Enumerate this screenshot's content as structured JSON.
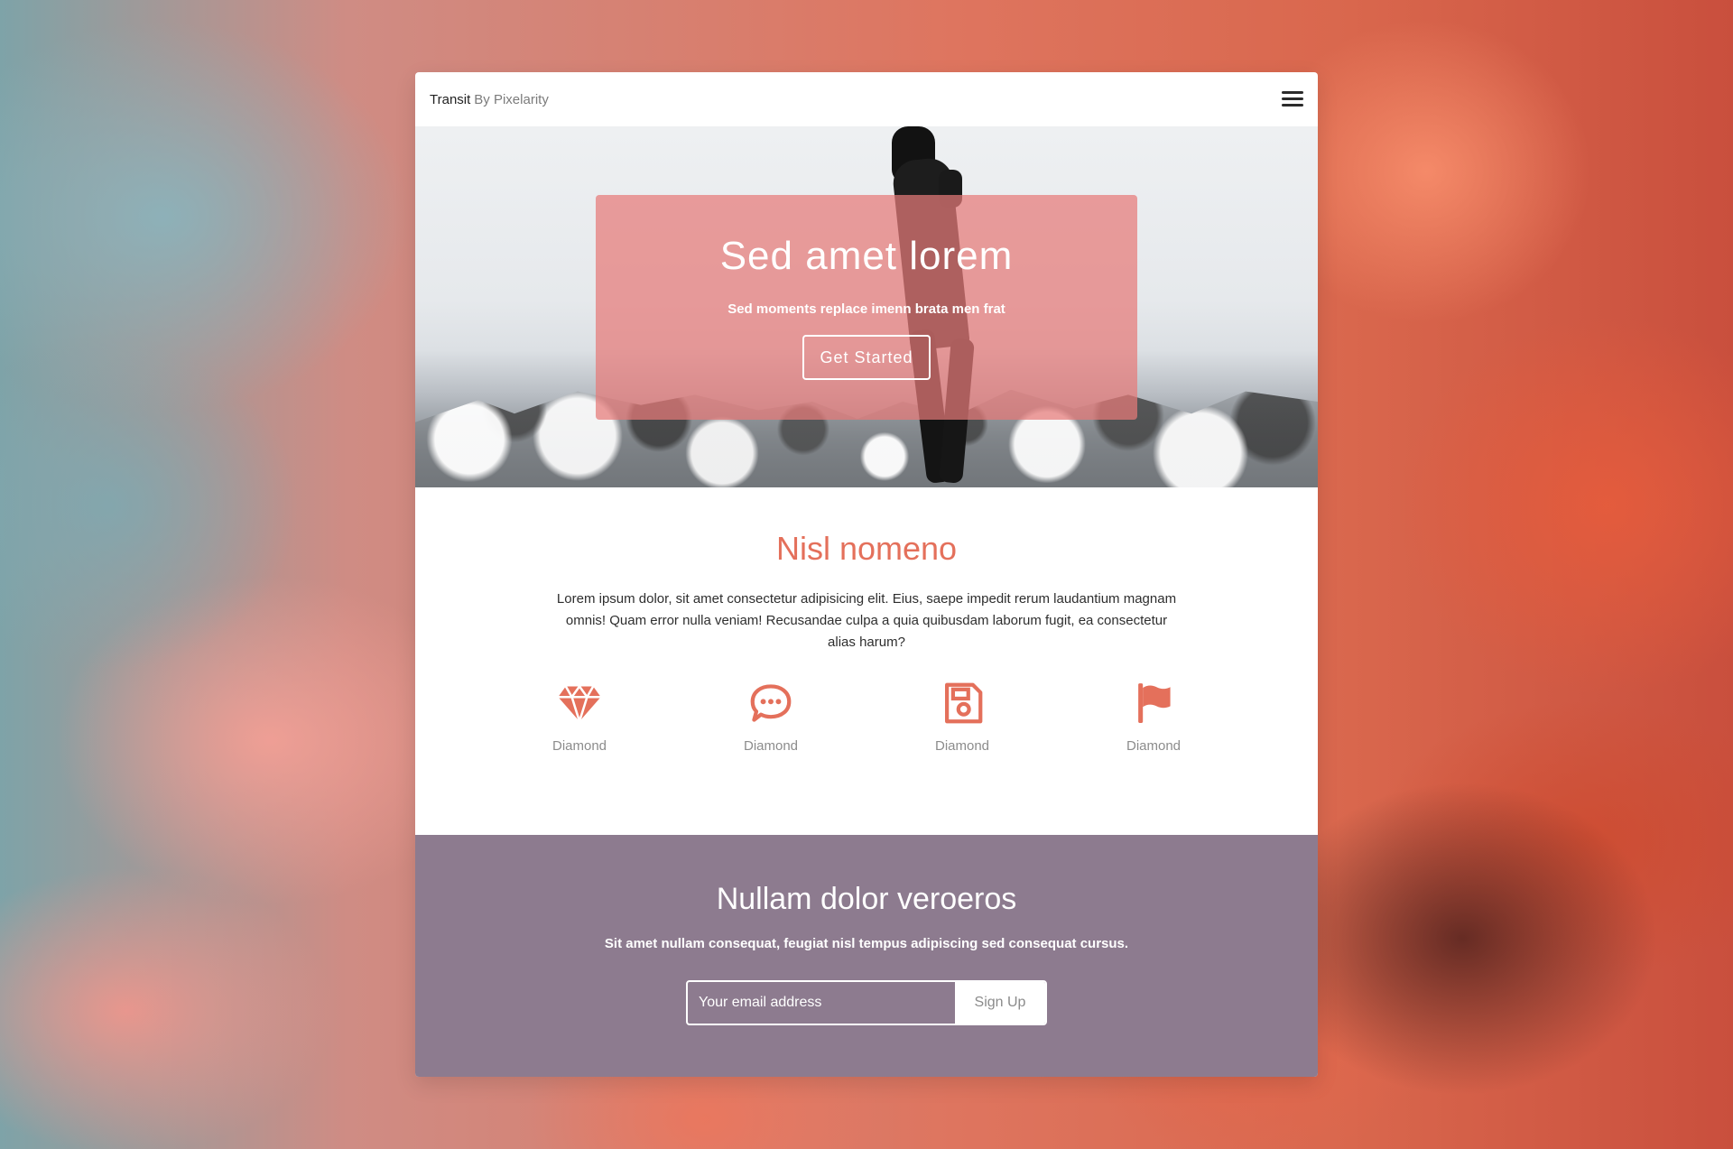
{
  "brand": {
    "name": "Transit",
    "by": "By Pixelarity"
  },
  "header": {
    "menu_icon": "hamburger-menu-icon"
  },
  "hero": {
    "title": "Sed amet lorem",
    "subtitle": "Sed moments replace imenn brata men frat",
    "button_label": "Get Started"
  },
  "features": {
    "title": "Nisl nomeno",
    "text": "Lorem ipsum dolor, sit amet consectetur adipisicing elit. Eius, saepe impedit rerum laudantium magnam omnis! Quam error nulla veniam! Recusandae culpa a quia quibusdam laborum fugit, ea consectetur alias harum?",
    "items": [
      {
        "icon": "diamond-icon",
        "label": "Diamond"
      },
      {
        "icon": "chat-icon",
        "label": "Diamond"
      },
      {
        "icon": "save-icon",
        "label": "Diamond"
      },
      {
        "icon": "flag-icon",
        "label": "Diamond"
      }
    ]
  },
  "signup": {
    "title": "Nullam dolor veroeros",
    "text": "Sit amet nullam consequat, feugiat nisl tempus adipiscing sed consequat cursus.",
    "email_placeholder": "Your email address",
    "button_label": "Sign Up"
  },
  "colors": {
    "accent": "#e4705b",
    "hero_overlay": "#e67a78",
    "signup_bg": "#8d7b8f",
    "text": "#2e2e2e"
  }
}
